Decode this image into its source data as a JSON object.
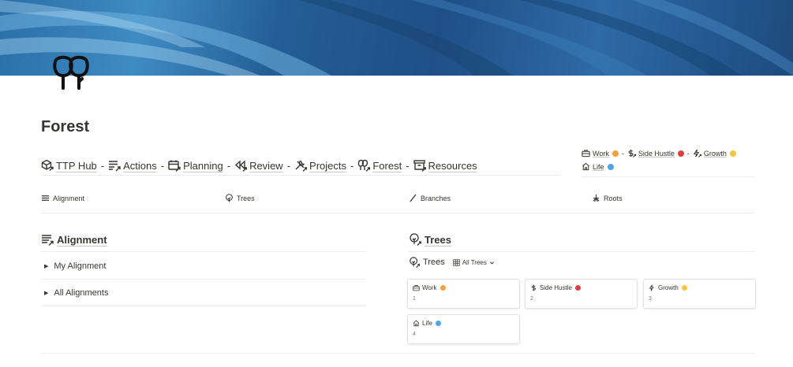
{
  "page": {
    "title": "Forest"
  },
  "nav": [
    {
      "label": "TTP Hub",
      "icon": "cube-arrow-icon"
    },
    {
      "label": "Actions",
      "icon": "list-arrow-icon"
    },
    {
      "label": "Planning",
      "icon": "calendar-arrow-icon"
    },
    {
      "label": "Review",
      "icon": "rewind-arrow-icon"
    },
    {
      "label": "Projects",
      "icon": "tools-arrow-icon"
    },
    {
      "label": "Forest",
      "icon": "trees-arrow-icon"
    },
    {
      "label": "Resources",
      "icon": "archive-arrow-icon"
    }
  ],
  "nav_separator": "-",
  "areas": [
    {
      "label": "Work",
      "color": "#f0a13a",
      "icon": "briefcase-icon"
    },
    {
      "label": "Side Hustle",
      "color": "#e03e3e",
      "icon": "dollar-icon"
    },
    {
      "label": "Growth",
      "color": "#f5c542",
      "icon": "bolt-icon"
    },
    {
      "label": "Life",
      "color": "#4ea6e6",
      "icon": "house-icon"
    }
  ],
  "tabs": [
    {
      "label": "Alignment",
      "icon": "lines-icon"
    },
    {
      "label": "Trees",
      "icon": "tree-icon"
    },
    {
      "label": "Branches",
      "icon": "branch-icon"
    },
    {
      "label": "Roots",
      "icon": "roots-icon"
    }
  ],
  "alignment": {
    "title": "Alignment",
    "toggles": [
      "My Alignment",
      "All Alignments"
    ]
  },
  "trees": {
    "title": "Trees",
    "view_title": "Trees",
    "view_selector": "All Trees",
    "cards": [
      {
        "label": "Work",
        "number": "1",
        "color": "#f0a13a",
        "icon": "briefcase-icon"
      },
      {
        "label": "Side Hustle",
        "number": "2",
        "color": "#e03e3e",
        "icon": "dollar-icon"
      },
      {
        "label": "Growth",
        "number": "3",
        "color": "#f5c542",
        "icon": "bolt-icon"
      },
      {
        "label": "Life",
        "number": "4",
        "color": "#4ea6e6",
        "icon": "house-icon"
      }
    ]
  }
}
